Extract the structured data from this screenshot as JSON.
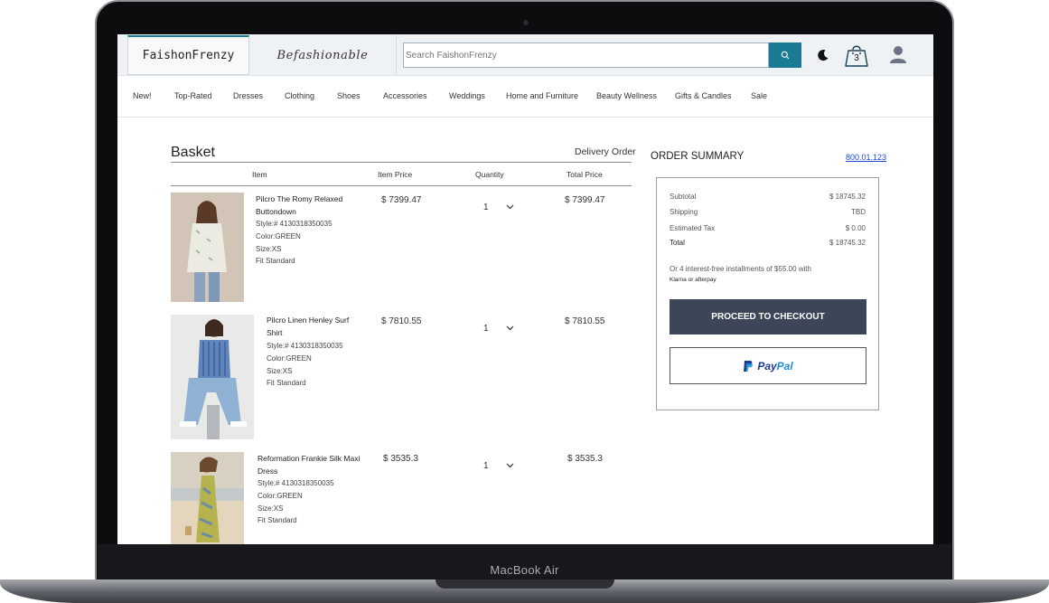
{
  "device": {
    "label": "MacBook Air"
  },
  "header": {
    "logo": "FaishonFrenzy",
    "brand_tab": "Befashionable",
    "search_placeholder": "Search FaishonFrenzy",
    "cart_count": "3"
  },
  "nav": {
    "items": [
      "New!",
      "Top-Rated",
      "Dresses",
      "Clothing",
      "Shoes",
      "Accessories",
      "Weddings",
      "Home and Furniture",
      "Beauty Wellness",
      "Gifts & Candles",
      "Sale"
    ]
  },
  "basket": {
    "title": "Basket",
    "delivery_label": "Delivery Order",
    "columns": {
      "item": "Item",
      "item_price": "Item Price",
      "quantity": "Quantity",
      "total_price": "Total Price"
    },
    "items": [
      {
        "name": "Pilcro The Romy Relaxed Buttondown",
        "style": "Style:# 4130318350035",
        "color": "Color:GREEN",
        "size": "Size:XS",
        "fit": "Fit Standard",
        "price": "$ 7399.47",
        "qty": "1",
        "total": "$ 7399.47"
      },
      {
        "name": "Pilcro Linen Henley Surf Shirt",
        "style": "Style:# 4130318350035",
        "color": "Color:GREEN",
        "size": "Size:XS",
        "fit": "Fit Standard",
        "price": "$ 7810.55",
        "qty": "1",
        "total": "$ 7810.55"
      },
      {
        "name": "Reformation Frankie Silk Maxi Dress",
        "style": "Style:# 4130318350035",
        "color": "Color:GREEN",
        "size": "Size:XS",
        "fit": "Fit Standard",
        "price": "$ 3535.3",
        "qty": "1",
        "total": "$ 3535.3"
      }
    ]
  },
  "summary": {
    "title": "ORDER SUMMARY",
    "phone": "800.01.123",
    "subtotal_label": "Subtotal",
    "subtotal": "$ 18745.32",
    "shipping_label": "Shipping",
    "shipping": "TBD",
    "tax_label": "Estimated Tax",
    "tax": "$ 0.00",
    "total_label": "Total",
    "total": "$ 18745.32",
    "installment_text": "Or 4 interest-free installments of $55.00 with",
    "klarna_text": "Klarna or afterpay",
    "checkout_label": "PROCEED TO CHECKOUT",
    "paypal_label_1": "Pay",
    "paypal_label_2": "Pal"
  },
  "colors": {
    "accent": "#1a7b94",
    "checkout": "#3d4658",
    "link": "#1a47d6"
  }
}
